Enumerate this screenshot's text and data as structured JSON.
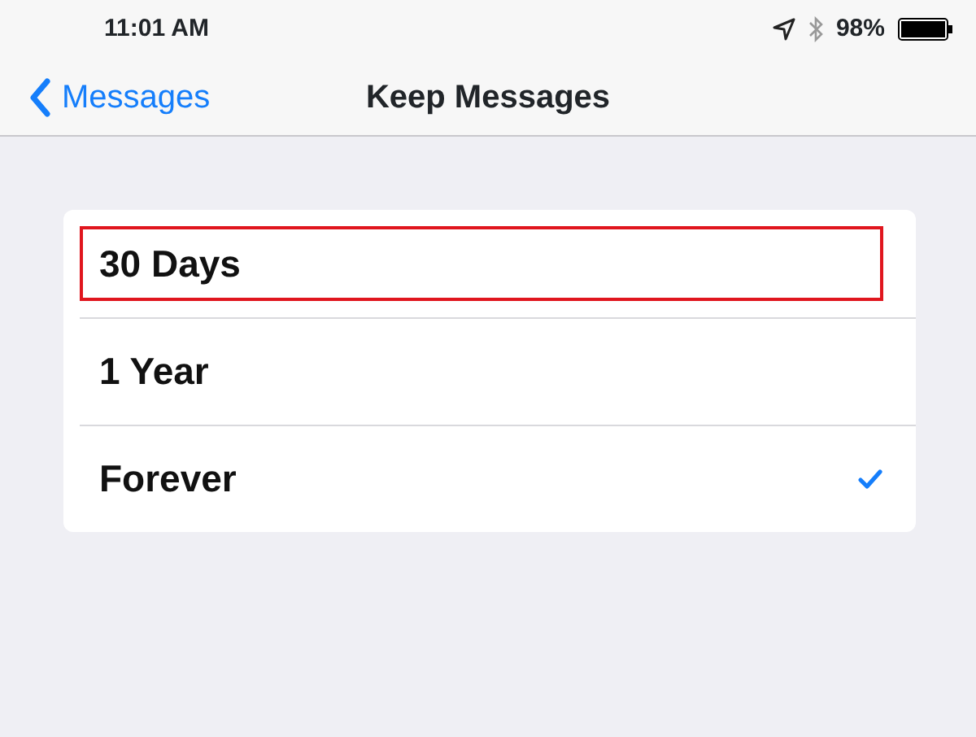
{
  "status_bar": {
    "time": "11:01 AM",
    "battery": "98%"
  },
  "nav_bar": {
    "back": "Messages",
    "title": "Keep Messages"
  },
  "options": [
    {
      "label": "30 Days",
      "selected": false,
      "highlighted": true
    },
    {
      "label": "1 Year",
      "selected": false,
      "highlighted": false
    },
    {
      "label": "Forever",
      "selected": true,
      "highlighted": false
    }
  ]
}
